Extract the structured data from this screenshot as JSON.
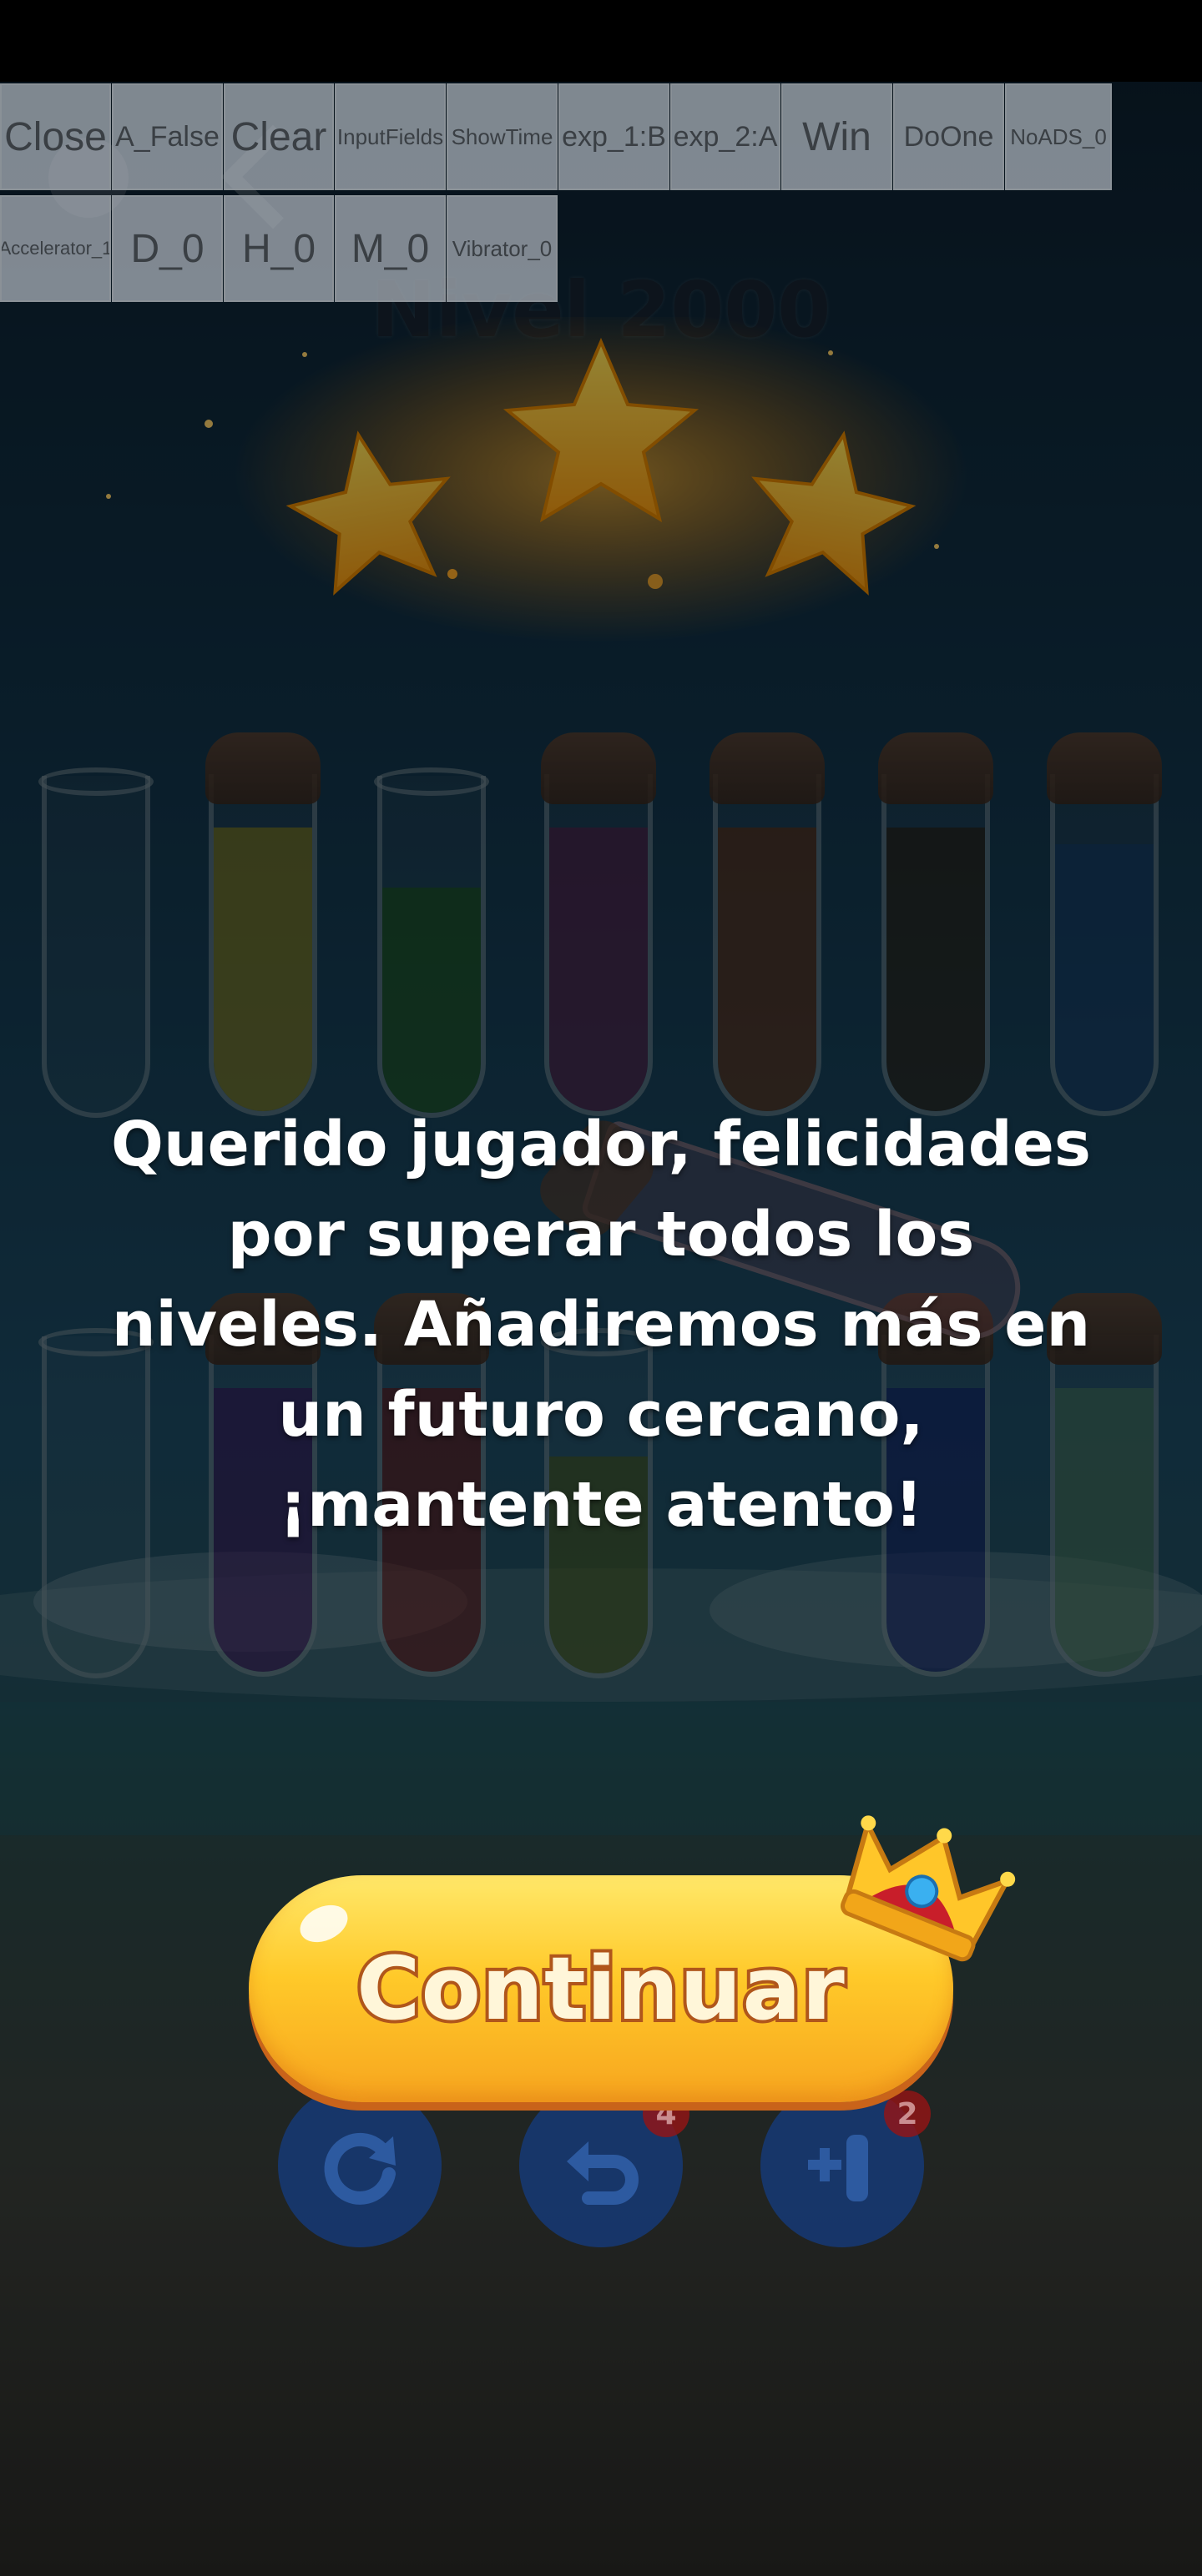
{
  "debug_buttons": {
    "row1": [
      "Close",
      "A_False",
      "Clear",
      "InputFields",
      "ShowTime",
      "exp_1:B",
      "exp_2:A",
      "Win",
      "DoOne",
      "NoADS_0"
    ],
    "row2": [
      "Accelerator_1",
      "D_0",
      "H_0",
      "M_0",
      "Vibrator_0"
    ]
  },
  "level": {
    "title": "Nivel 2000"
  },
  "stars": {
    "count": 3,
    "earned": 3
  },
  "message": {
    "line1": "Querido jugador, felicidades",
    "line2": "por superar todos los",
    "line3": "niveles. Añadiremos más en",
    "line4": "un futuro cercano,",
    "line5": "¡mantente atento!"
  },
  "continue_button": {
    "label": "Continuar"
  },
  "bottom_controls": {
    "restart": {
      "icon": "refresh-icon"
    },
    "undo": {
      "icon": "undo-icon",
      "badge": "4"
    },
    "add_tube": {
      "icon": "add-tube-icon",
      "badge": "2"
    }
  },
  "colors": {
    "button_yellow": "#ffc929",
    "button_stroke": "#b0561b",
    "debug_button_bg": "#afb6be"
  }
}
